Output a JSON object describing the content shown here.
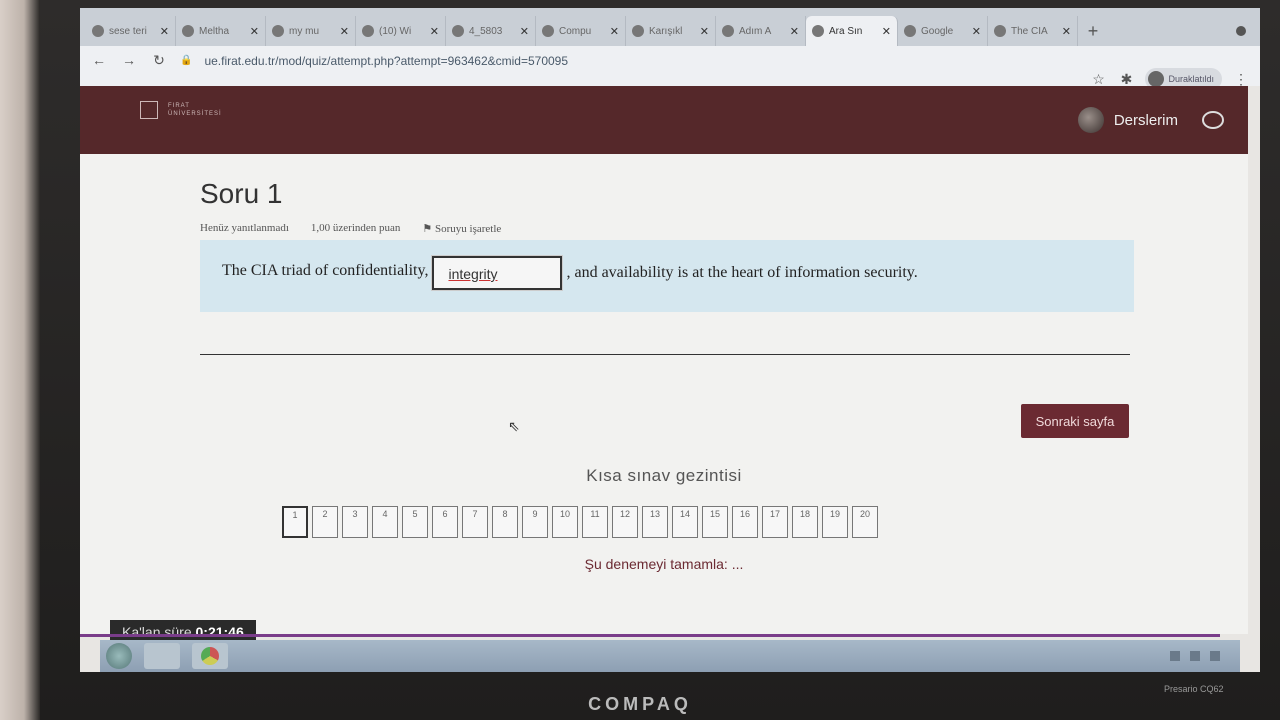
{
  "browser": {
    "tabs": [
      {
        "label": "sese teri",
        "active": false
      },
      {
        "label": "Meltha",
        "active": false
      },
      {
        "label": "my mu",
        "active": false
      },
      {
        "label": "(10) Wi",
        "active": false
      },
      {
        "label": "4_5803",
        "active": false
      },
      {
        "label": "Compu",
        "active": false
      },
      {
        "label": "Karışıkl",
        "active": false
      },
      {
        "label": "Adım A",
        "active": false
      },
      {
        "label": "Ara Sın",
        "active": true
      },
      {
        "label": "Google",
        "active": false
      },
      {
        "label": "The CIA",
        "active": false
      }
    ],
    "url": "ue.firat.edu.tr/mod/quiz/attempt.php?attempt=963462&cmid=570095",
    "profile_label": "Duraklatıldı"
  },
  "header": {
    "logo_line1": "FIRAT",
    "logo_line2": "ÜNİVERSİTESİ",
    "courses_label": "Derslerim"
  },
  "question": {
    "title": "Soru 1",
    "status": "Henüz yanıtlanmadı",
    "points": "1,00 üzerinden puan",
    "flag_label": "Soruyu işaretle",
    "text_before": "The CIA triad of confidentiality,",
    "answer_value": "integrity",
    "text_after": ", and availability is at the heart of information security."
  },
  "next_button": "Sonraki sayfa",
  "quiz_nav": {
    "heading": "Kısa sınav gezintisi",
    "cells": [
      "1",
      "2",
      "3",
      "4",
      "5",
      "6",
      "7",
      "8",
      "9",
      "10",
      "11",
      "12",
      "13",
      "14",
      "15",
      "16",
      "17",
      "18",
      "19",
      "20"
    ],
    "finish_label": "Şu denemeyi tamamla: ..."
  },
  "timer": {
    "label": "Ka'lan süre",
    "value": "0:21:46"
  },
  "device": {
    "brand": "COMPAQ",
    "model": "Presario CQ62"
  }
}
